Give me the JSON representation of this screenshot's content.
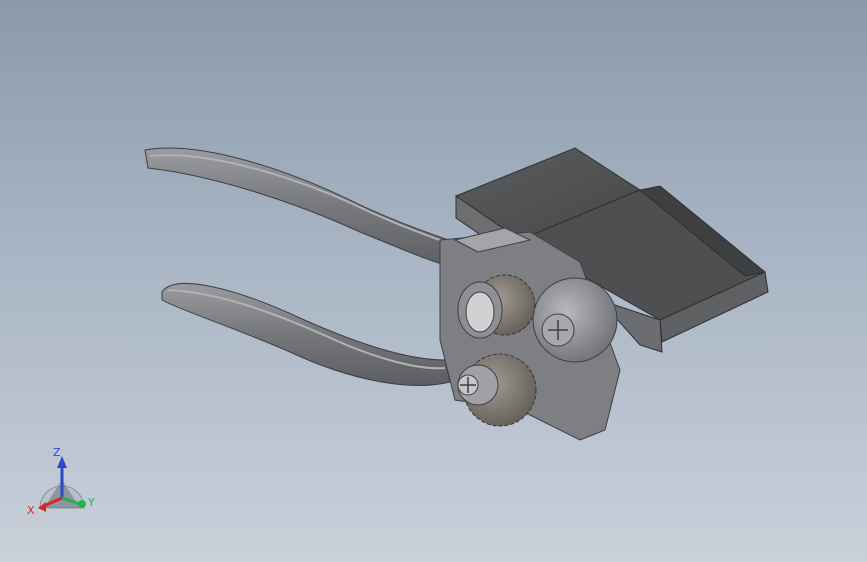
{
  "viewport": {
    "background_top": "#8a99ab",
    "background_bottom": "#c9d0da"
  },
  "model": {
    "part_color": "#7d7f82",
    "dark_block_color": "#4a4c4e"
  },
  "triad": {
    "x_label": "X",
    "y_label": "Y",
    "z_label": "Z",
    "x_color": "#d8262a",
    "y_color": "#23b34a",
    "z_color": "#2c49c9"
  }
}
